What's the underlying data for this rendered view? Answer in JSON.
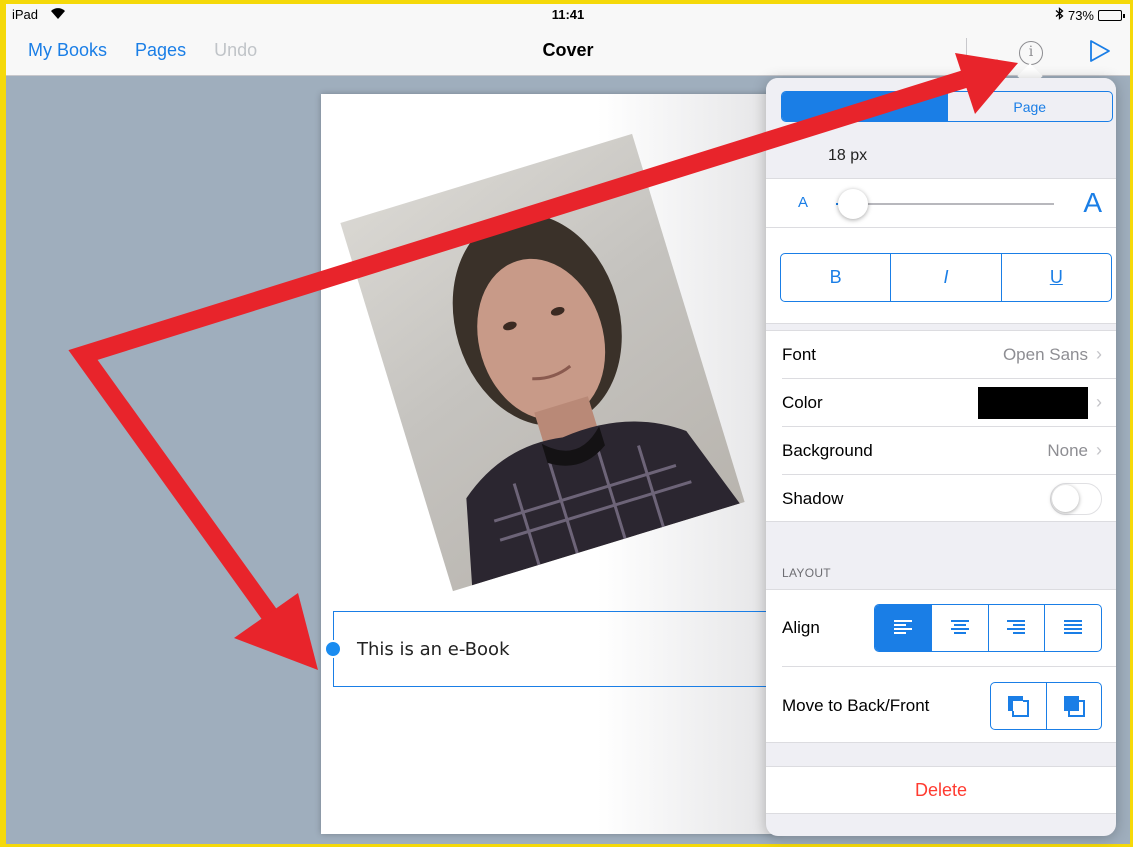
{
  "status_bar": {
    "device": "iPad",
    "time": "11:41",
    "battery": "73%",
    "battery_level": 0.73
  },
  "nav": {
    "my_books": "My Books",
    "pages": "Pages",
    "undo": "Undo",
    "title": "Cover"
  },
  "document": {
    "text_box": "This is an e-Book"
  },
  "popover": {
    "tabs": [
      "",
      "Page"
    ],
    "font_size": "18 px",
    "slider": {
      "small_label": "A",
      "large_label": "A",
      "level": 0.08
    },
    "style_buttons": [
      "B",
      "I",
      "U"
    ],
    "font": {
      "label": "Font",
      "value": "Open Sans"
    },
    "color": {
      "label": "Color",
      "swatch": "#000000"
    },
    "background": {
      "label": "Background",
      "value": "None"
    },
    "shadow": {
      "label": "Shadow"
    },
    "layout_header": "LAYOUT",
    "align": {
      "label": "Align"
    },
    "move": {
      "label": "Move to Back/Front"
    },
    "delete": "Delete"
  },
  "colors": {
    "accent": "#1a7ee6",
    "delete": "#ff3b30",
    "annotation_arrow": "#e8242b",
    "frame": "#f5d90a"
  }
}
